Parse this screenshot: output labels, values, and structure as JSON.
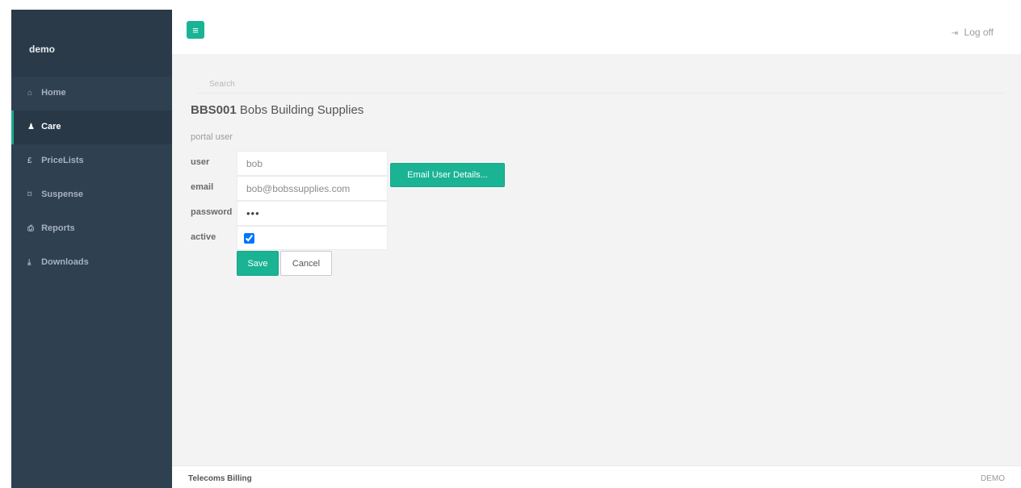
{
  "brand": "demo",
  "nav": [
    {
      "icon": "home-icon",
      "glyph": "⌂",
      "label": "Home"
    },
    {
      "icon": "user-icon",
      "glyph": "♟",
      "label": "Care"
    },
    {
      "icon": "pound-icon",
      "glyph": "£",
      "label": "PriceLists"
    },
    {
      "icon": "tag-icon",
      "glyph": "⌑",
      "label": "Suspense"
    },
    {
      "icon": "print-icon",
      "glyph": "⎙",
      "label": "Reports"
    },
    {
      "icon": "download-icon",
      "glyph": "⤓",
      "label": "Downloads"
    }
  ],
  "header": {
    "menu_glyph": "≡",
    "logoff_glyph": "⇥",
    "logoff_label": "Log off"
  },
  "search": {
    "placeholder": "Search"
  },
  "customer": {
    "code": "BBS001",
    "name": "Bobs Building Supplies"
  },
  "section": "portal user",
  "form": {
    "user_label": "user",
    "user_value": "bob",
    "email_label": "email",
    "email_value": "bob@bobssupplies.com",
    "password_label": "password",
    "password_value": "•••",
    "active_label": "active",
    "active_checked": true
  },
  "buttons": {
    "email_details": "Email User Details...",
    "save": "Save",
    "cancel": "Cancel"
  },
  "footer": {
    "left": "Telecoms Billing",
    "right": "DEMO"
  },
  "colors": {
    "accent": "#1ab394",
    "sidebar": "#2f4050"
  }
}
